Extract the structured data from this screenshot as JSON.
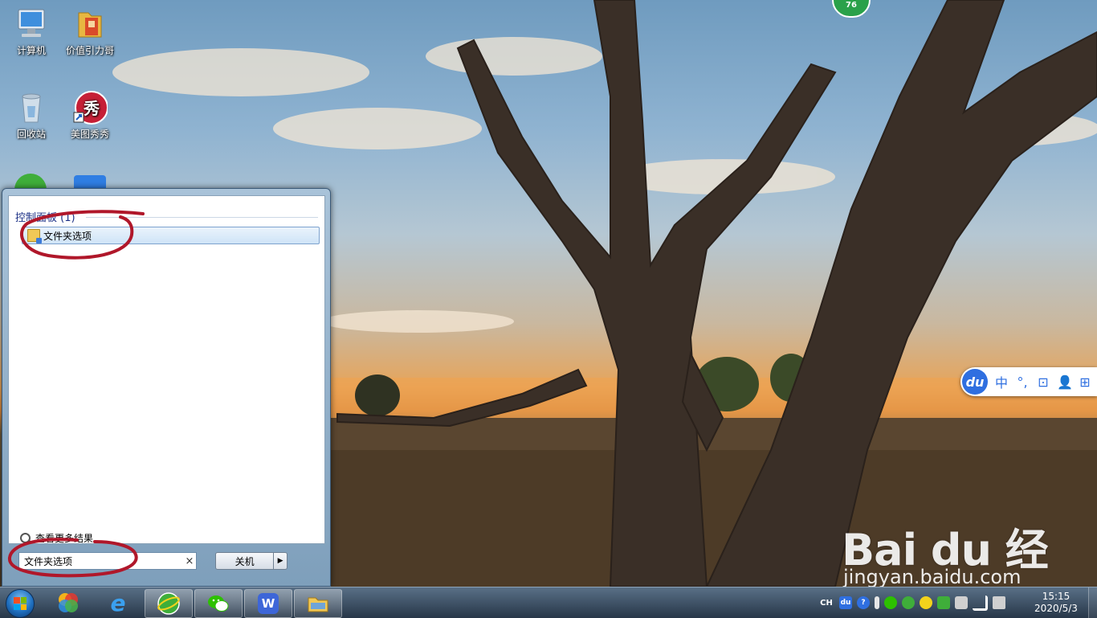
{
  "desktop": {
    "icons": [
      {
        "label": "计算机",
        "icon": "computer-icon"
      },
      {
        "label": "价值引力哥",
        "icon": "folder-icon"
      },
      {
        "label": "回收站",
        "icon": "recycle-bin-icon"
      },
      {
        "label": "美图秀秀",
        "icon": "meitu-icon",
        "glyph": "秀"
      }
    ],
    "badge": "76"
  },
  "ime_bar": {
    "logo": "du",
    "items": [
      "中",
      "°,",
      "⊡",
      "👤",
      "⊞"
    ]
  },
  "start_menu": {
    "results_header": "控制面板 (1)",
    "result_item": "文件夹选项",
    "see_more": "查看更多结果",
    "search": {
      "value": "文件夹选项",
      "clear": "×"
    },
    "shutdown": {
      "label": "关机",
      "arrow": "▶"
    }
  },
  "watermark": {
    "logo": "Bai du 经验",
    "url": "jingyan.baidu.com"
  },
  "taskbar": {
    "apps": [
      {
        "name": "360-icon"
      },
      {
        "name": "ie-icon",
        "glyph": "e"
      },
      {
        "name": "360-browser-icon"
      },
      {
        "name": "wechat-icon"
      },
      {
        "name": "wps-icon",
        "glyph": "W"
      },
      {
        "name": "explorer-icon"
      }
    ],
    "tray": {
      "lang": "CH",
      "ime": "du",
      "help": "?"
    },
    "clock": {
      "time": "15:15",
      "date": "2020/5/3"
    }
  },
  "colors": {
    "accent": "#2f6fe0",
    "annotation": "#b0172a",
    "taskbar": "#2a4058"
  }
}
